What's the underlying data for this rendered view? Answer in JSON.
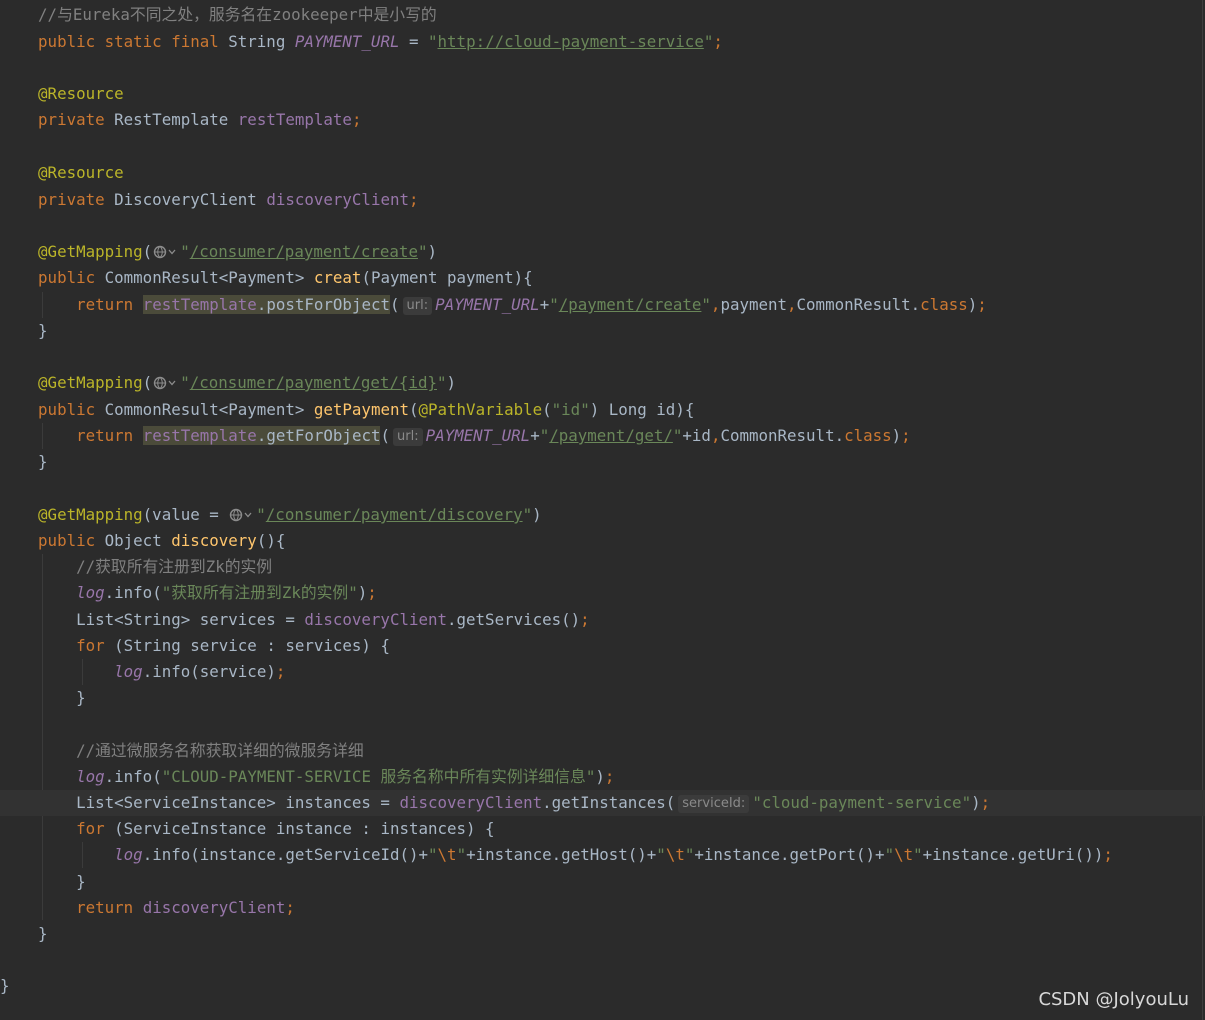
{
  "comment_zookeeper": "//与Eureka不同之处，服务名在zookeeper中是小写的",
  "payment_url_field": "PAYMENT_URL",
  "payment_url_value": "http://cloud-payment-service",
  "rest_template_type": "RestTemplate",
  "rest_template_field": "restTemplate",
  "discovery_client_type": "DiscoveryClient",
  "discovery_client_field": "discoveryClient",
  "create_mapping_path": "/consumer/payment/create",
  "create_method": "creat",
  "create_call_path": "/payment/create",
  "post_method": "postForObject",
  "get_mapping_path": "/consumer/payment/get/{id}",
  "get_method": "getPayment",
  "path_var_name": "id",
  "get_call_path": "/payment/get/",
  "get_for_object": "getForObject",
  "discovery_mapping_path": "/consumer/payment/discovery",
  "discovery_method": "discovery",
  "comment_get_all": "//获取所有注册到Zk的实例",
  "log_get_all": "获取所有注册到Zk的实例",
  "comment_details": "//通过微服务名称获取详细的微服务详细",
  "log_service_info": "CLOUD-PAYMENT-SERVICE 服务名称中所有实例详细信息",
  "service_id_value": "cloud-payment-service",
  "hint_url": "url:",
  "hint_service_id": "serviceId:",
  "tab_escape": "\\t",
  "watermark": "CSDN @JolyouLu",
  "colors": {
    "background": "#2b2b2b",
    "keyword": "#cc7832",
    "field": "#9876aa",
    "string": "#6a8759",
    "annotation": "#bbb529",
    "method": "#ffc66d",
    "comment": "#808080",
    "text": "#a9b7c6"
  },
  "icons": {
    "url_marker": "globe-icon"
  }
}
